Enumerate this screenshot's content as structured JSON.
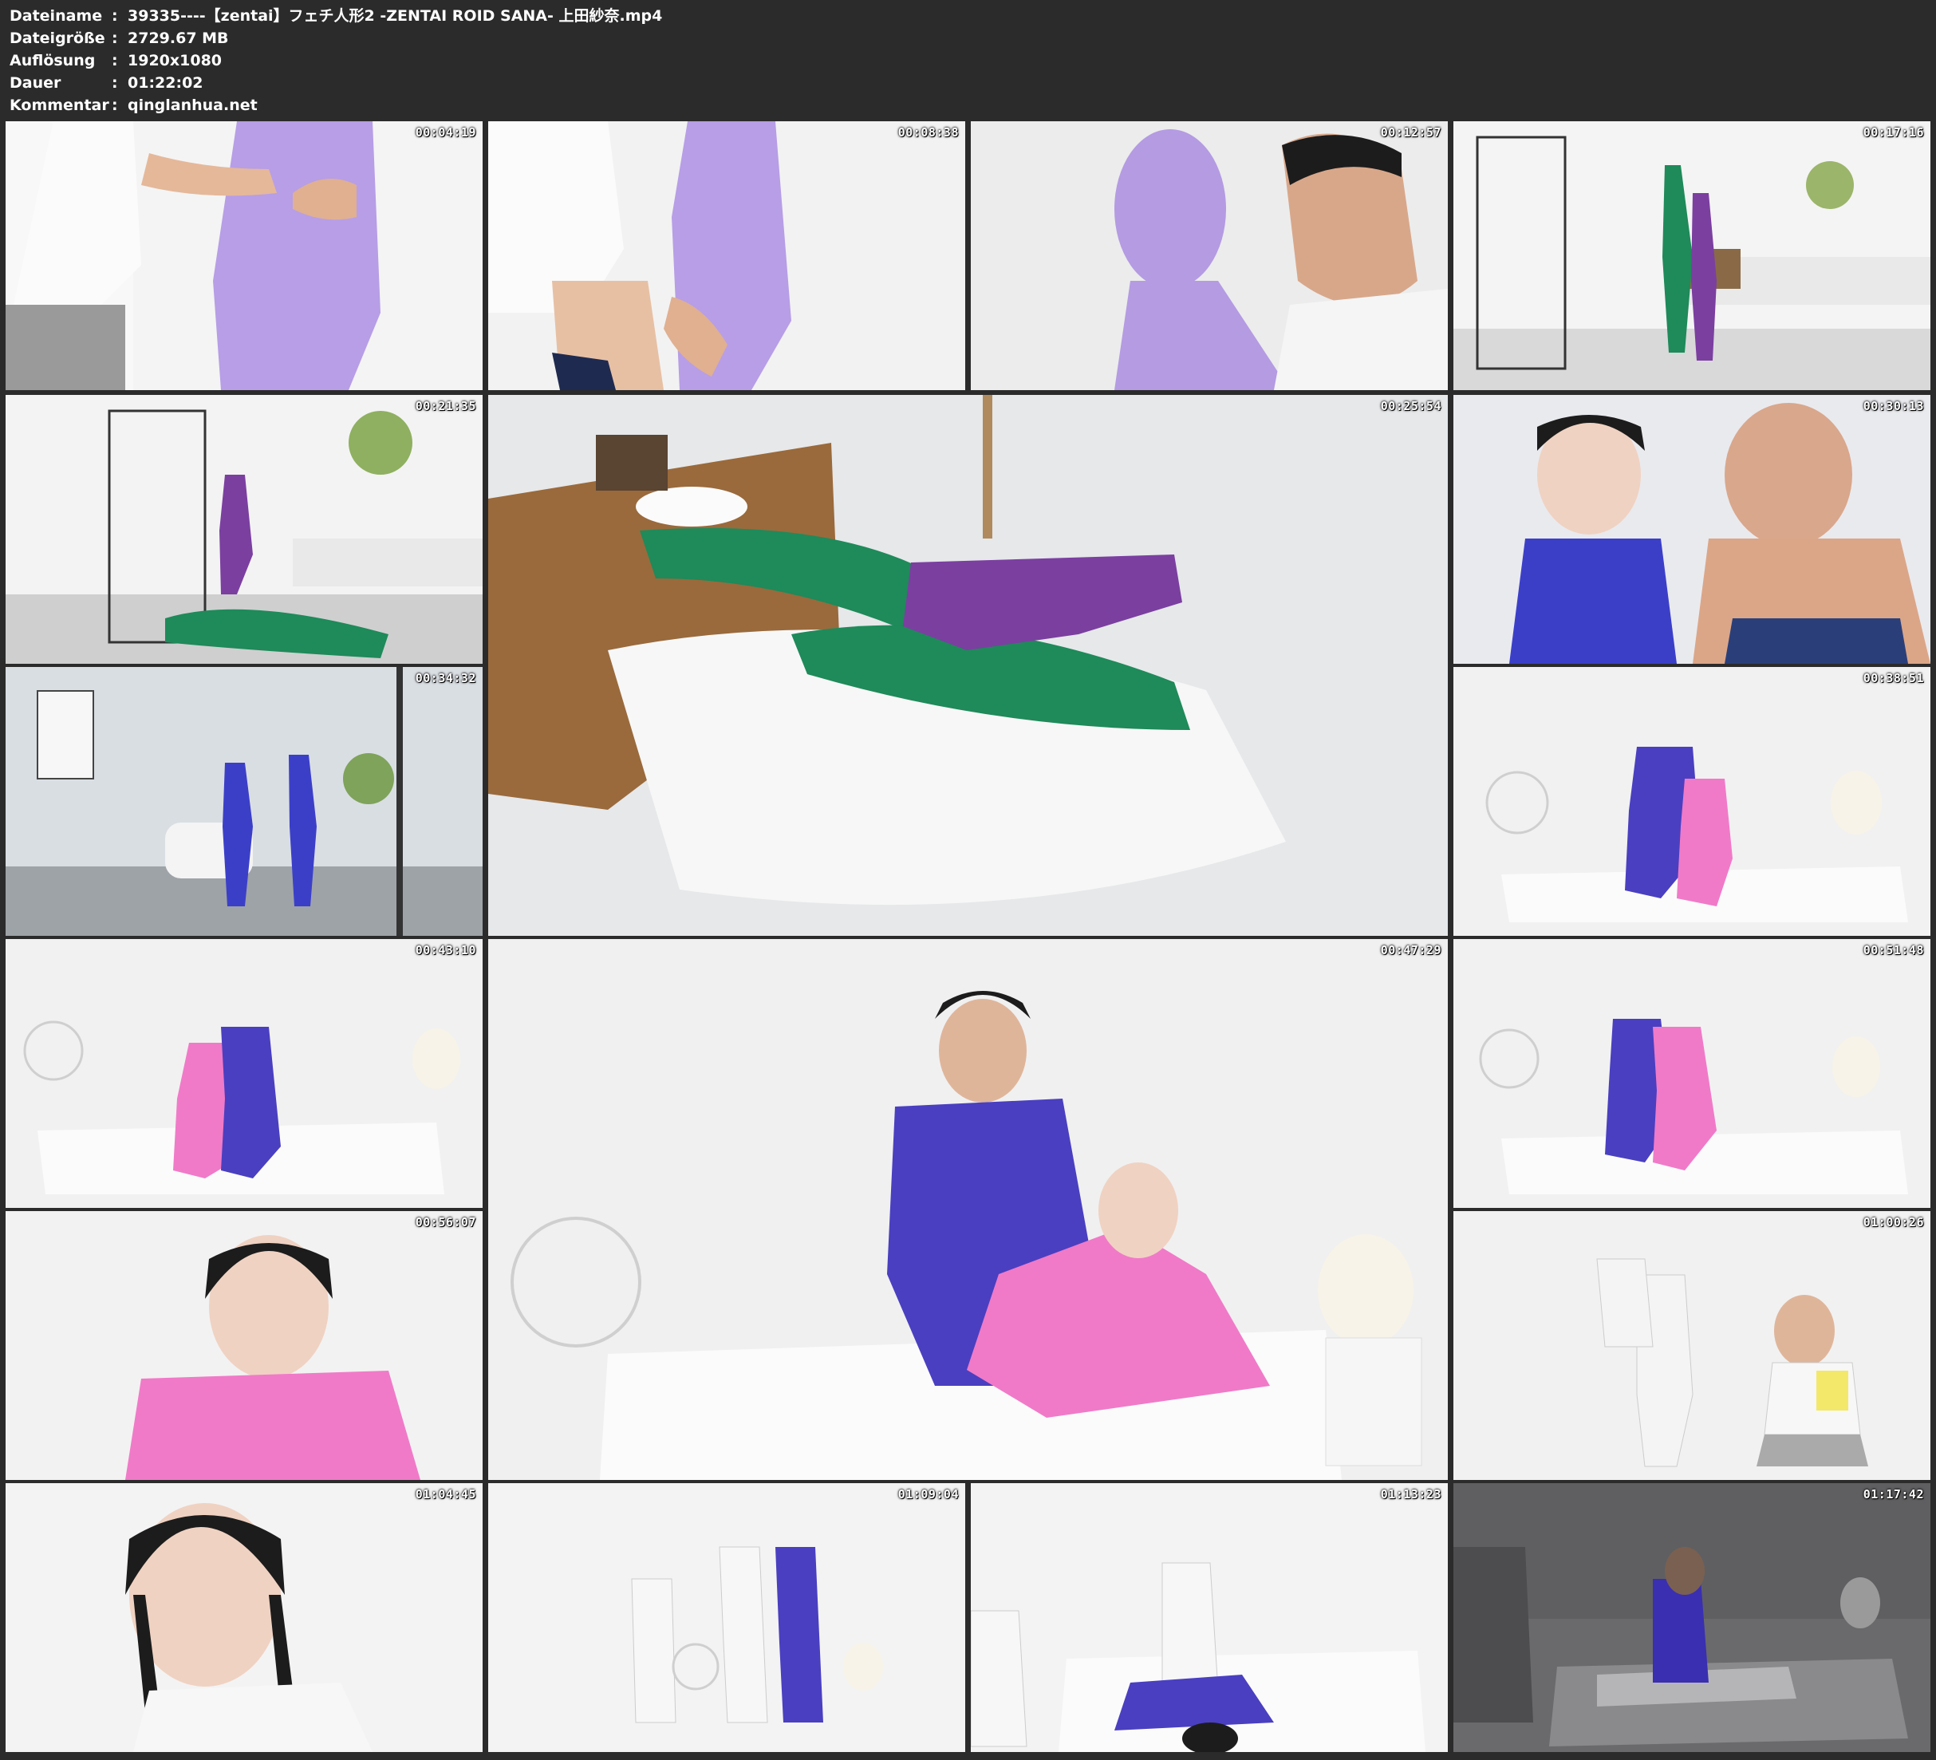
{
  "info": {
    "rows": [
      {
        "label": "Dateiname",
        "sep": ":",
        "value": "39335----【zentai】フェチ人形2 -ZENTAI ROID SANA- 上田紗奈.mp4"
      },
      {
        "label": "Dateigröße",
        "sep": ":",
        "value": "2729.67 MB"
      },
      {
        "label": "Auflösung",
        "sep": ":",
        "value": "1920x1080"
      },
      {
        "label": "Dauer",
        "sep": ":",
        "value": "01:22:02"
      },
      {
        "label": "Kommentar",
        "sep": ":",
        "value": "qinglanhua.net"
      }
    ]
  },
  "thumbnails": [
    {
      "timestamp": "00:04:19"
    },
    {
      "timestamp": "00:08:38"
    },
    {
      "timestamp": "00:12:57"
    },
    {
      "timestamp": "00:17:16"
    },
    {
      "timestamp": "00:21:35"
    },
    {
      "timestamp": "00:25:54"
    },
    {
      "timestamp": "00:30:13"
    },
    {
      "timestamp": "00:34:32"
    },
    {
      "timestamp": "00:38:51"
    },
    {
      "timestamp": "00:43:10"
    },
    {
      "timestamp": "00:47:29"
    },
    {
      "timestamp": "00:51:48"
    },
    {
      "timestamp": "00:56:07"
    },
    {
      "timestamp": "01:00:26"
    },
    {
      "timestamp": "01:04:45"
    },
    {
      "timestamp": "01:09:04"
    },
    {
      "timestamp": "01:13:23"
    },
    {
      "timestamp": "01:17:42"
    }
  ],
  "colors": {
    "background": "#2b2b2b",
    "header_text": "#ffffff",
    "suit_purple": "#a68fd8",
    "suit_violet": "#7b3fa0",
    "suit_green": "#1f8a5a",
    "suit_blue": "#4a3fc0",
    "suit_pink": "#f07ac8",
    "suit_white": "#f2f2f2"
  }
}
